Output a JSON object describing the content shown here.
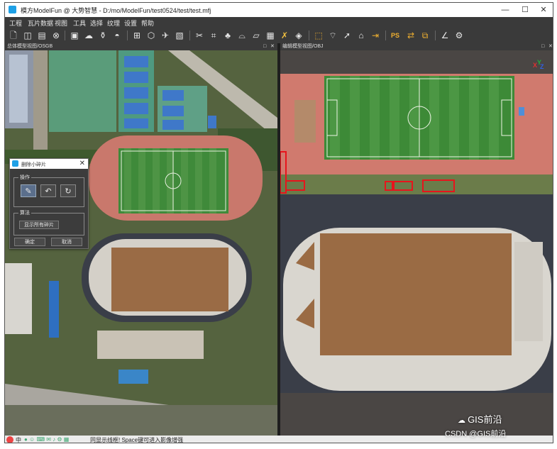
{
  "window": {
    "title": "模方ModelFun @ 大势智慧 - D:/mo/ModelFun/test0524/test/test.mfj",
    "minimize": "—",
    "maximize": "☐",
    "close": "✕"
  },
  "menu": [
    "工程",
    "瓦片数据",
    "视图",
    "工具",
    "选择",
    "纹理",
    "设置",
    "帮助"
  ],
  "toolbar": {
    "icons": [
      "new-file-icon",
      "split-view-icon",
      "clipboard-icon",
      "clear-icon",
      "stop-icon",
      "cloud-icon",
      "vase-icon",
      "fill-icon",
      "grid-icon",
      "cube-icon",
      "airplane-icon",
      "image-icon",
      "scissors-icon",
      "crop-icon",
      "tree-icon",
      "bridge-icon",
      "flatten-icon",
      "building-icon",
      "brush-delete-icon",
      "paint-bucket-icon",
      "select-rect-icon",
      "select-lasso-icon",
      "cursor-icon",
      "basket-icon",
      "arrow-right-icon",
      "ps-icon",
      "texture-swap-icon",
      "layers-icon",
      "angle-icon",
      "gear-icon"
    ],
    "ps_label": "PS"
  },
  "panels": {
    "left_title": "总体模型视图/OSGB",
    "right_title": "编辑模型视图/OBJ",
    "float_icon": "□",
    "close_icon": "✕"
  },
  "dialog": {
    "title": "删除小碎片",
    "close": "✕",
    "group_ops_label": "操作",
    "group_algo_label": "算法",
    "show_all_label": "显示所有碎片",
    "ok_label": "确定",
    "cancel_label": "取消"
  },
  "axes": {
    "x": "X",
    "y": "Y",
    "z": "Z"
  },
  "statusbar": {
    "text": "同显示线框! Space键可进入影像增强",
    "ime_icon_text": "中"
  },
  "watermark": {
    "brand": "GIS前沿",
    "source": "CSDN @GIS前沿"
  },
  "colors": {
    "accent": "#1ea0e6",
    "selection_red": "#e8141c",
    "toolbar_bg": "#3a3a3a"
  }
}
